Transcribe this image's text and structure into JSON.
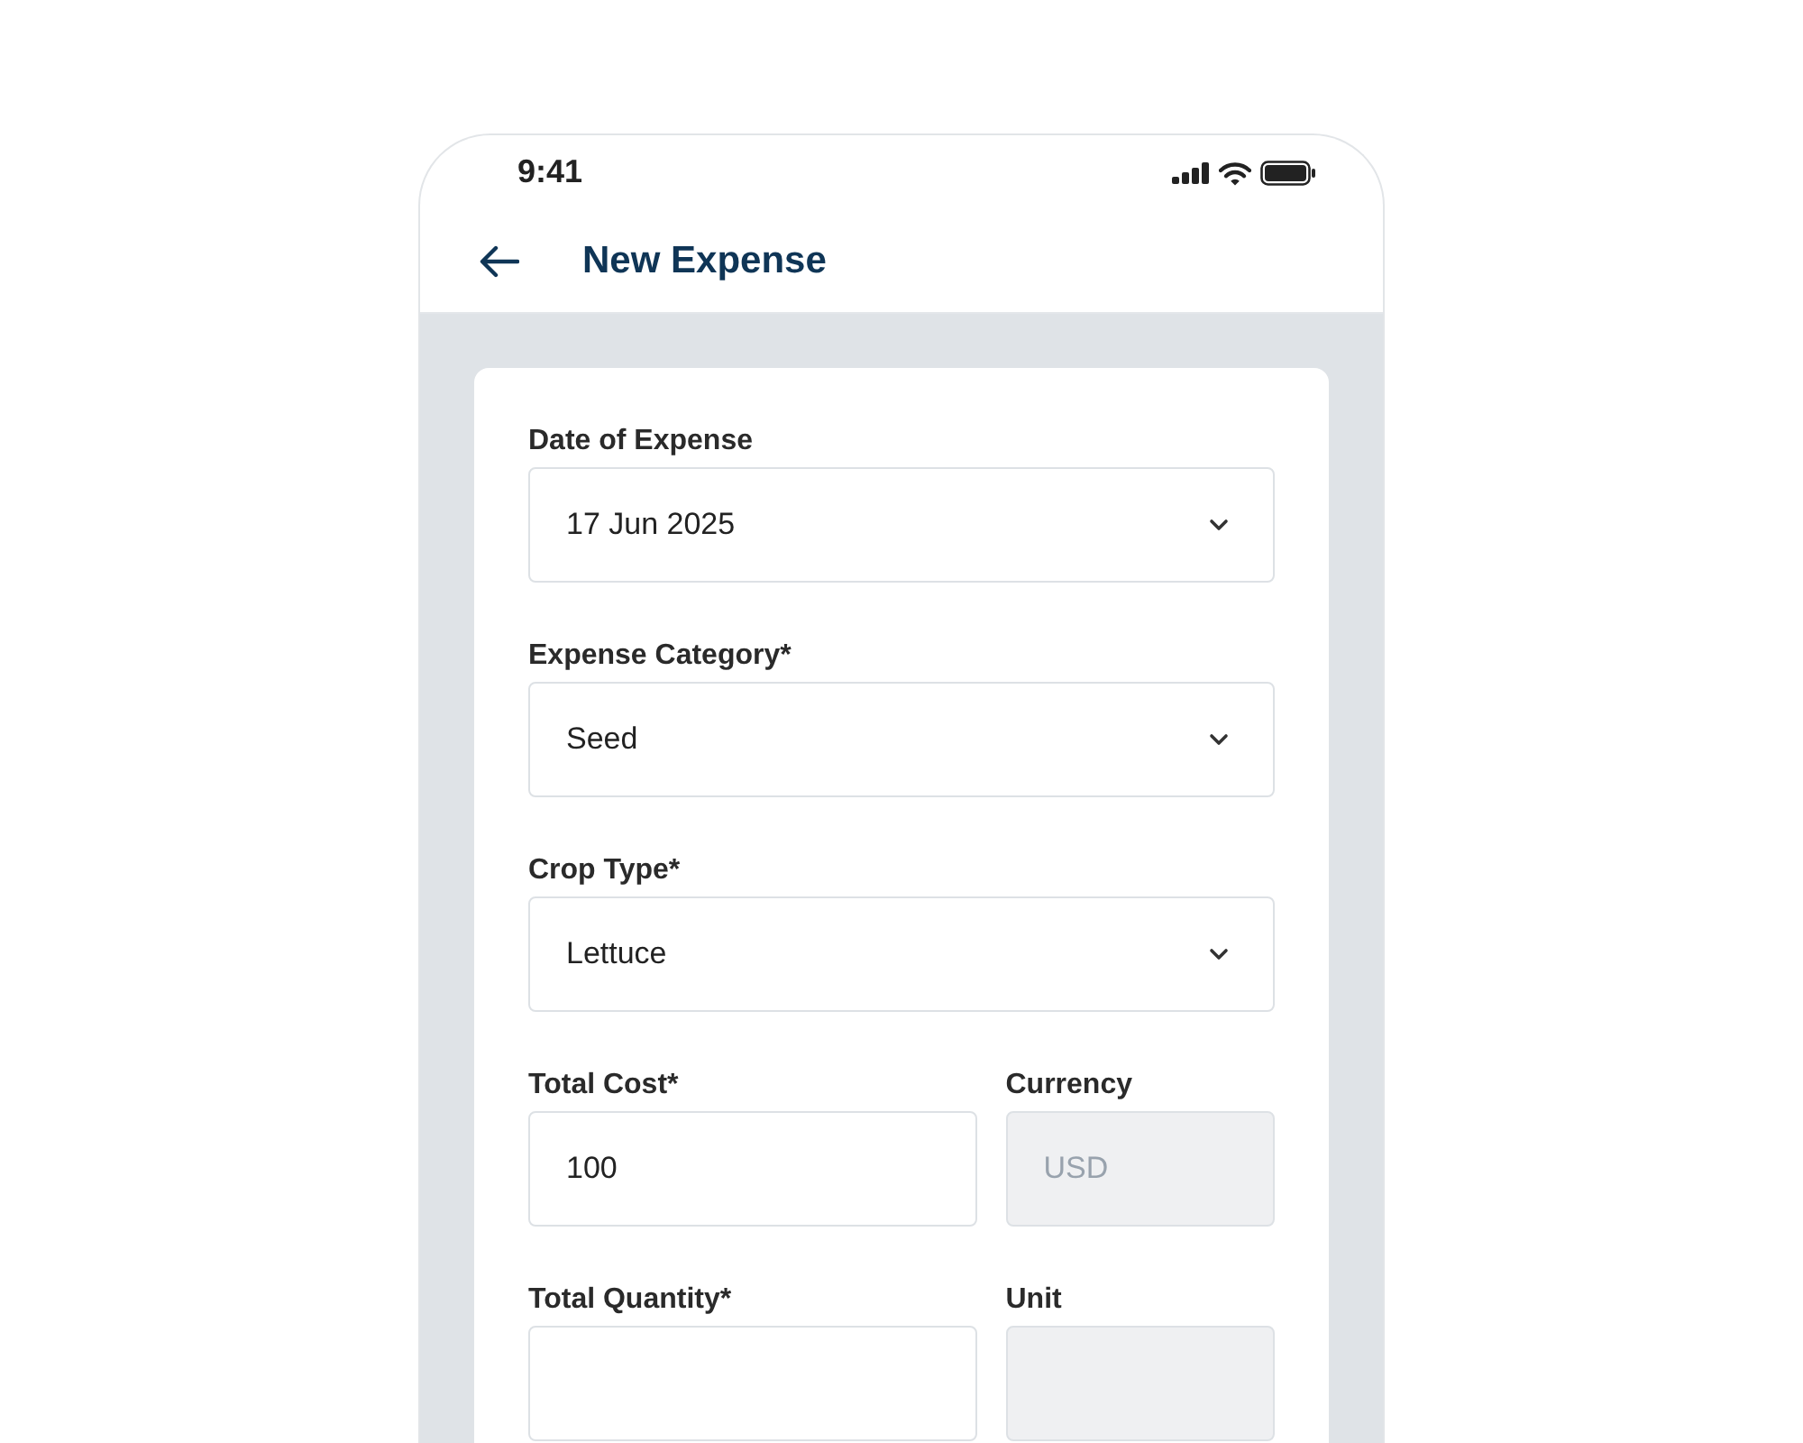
{
  "status_bar": {
    "time": "9:41"
  },
  "header": {
    "title": "New Expense"
  },
  "form": {
    "rows": [
      {
        "fields": [
          {
            "label": "Date of Expense",
            "kind": "select",
            "value": "17 Jun 2025"
          }
        ]
      },
      {
        "fields": [
          {
            "label": "Expense Category*",
            "kind": "select",
            "value": "Seed"
          }
        ]
      },
      {
        "fields": [
          {
            "label": "Crop Type*",
            "kind": "select",
            "value": "Lettuce"
          }
        ]
      },
      {
        "fields": [
          {
            "label": "Total Cost*",
            "kind": "text",
            "disabled": false,
            "value": "100"
          },
          {
            "label": "Currency",
            "kind": "text",
            "disabled": true,
            "value": "USD"
          }
        ]
      },
      {
        "fields": [
          {
            "label": "Total Quantity*",
            "kind": "text",
            "disabled": false
          },
          {
            "label": "Unit",
            "kind": "text",
            "disabled": true
          }
        ]
      }
    ]
  }
}
